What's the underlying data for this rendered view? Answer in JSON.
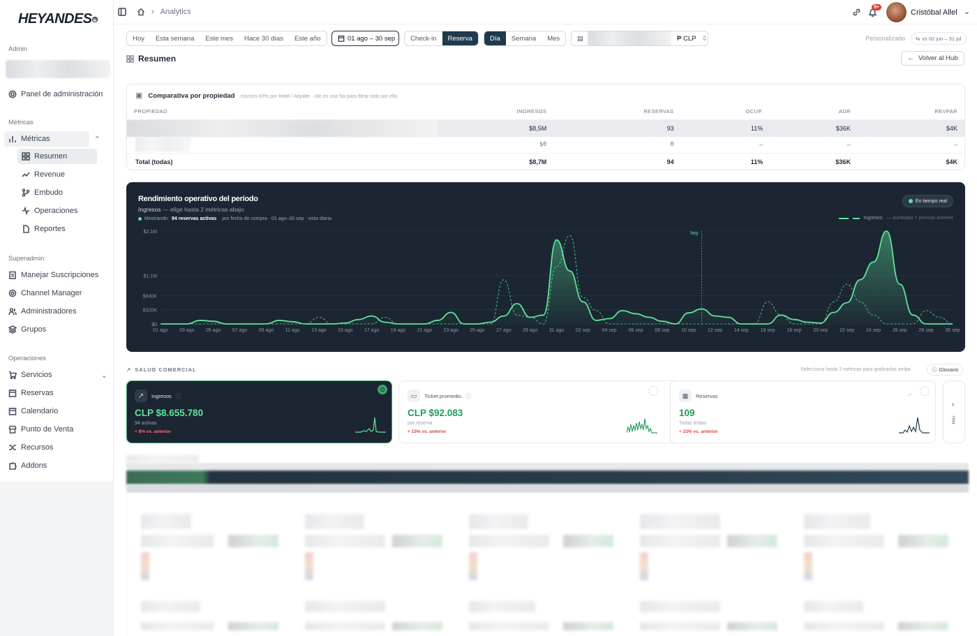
{
  "brand": {
    "logo_text": "HEYANDES"
  },
  "sidebar": {
    "section_admin": "Admin",
    "panel_admin": "Panel de administración",
    "section_metricas": "Métricas",
    "metricas": "Métricas",
    "metricas_items": [
      "Resumen",
      "Revenue",
      "Embudo",
      "Operaciones",
      "Reportes"
    ],
    "section_superadmin": "Superadmin",
    "superadmin_items": [
      "Manejar Suscripciones",
      "Channel Manager",
      "Administradores",
      "Grupos"
    ],
    "section_operaciones": "Operaciones",
    "operaciones_items": [
      "Servicios",
      "Reservas",
      "Calendario",
      "Punto de Venta",
      "Recursos",
      "Addons"
    ]
  },
  "header": {
    "breadcrumb": "Analytics",
    "notifications_badge": "9+",
    "user_name": "Cristóbal Allel"
  },
  "filters": {
    "ranges": [
      "Hoy",
      "Esta semana",
      "Este mes",
      "Hace 30 días",
      "Este año"
    ],
    "date_range": "01 ago – 30 sep",
    "date_type": [
      "Check-in",
      "Reserva"
    ],
    "date_type_selected": "Reserva",
    "granularity": [
      "Día",
      "Semana",
      "Mes"
    ],
    "granularity_selected": "Día",
    "currency": "CLP",
    "compare_label": "Personalizado",
    "compare_range": "vs 02 jun – 31 jul"
  },
  "page": {
    "title": "Resumen",
    "back_button": "Volver al Hub"
  },
  "comparison": {
    "title": "Comparativa por propiedad",
    "subtitle": "mismos KPIs por Hotel / Alquiler · clic en una fila para filtrar todo por ella",
    "columns": [
      "PROPIEDAD",
      "INGRESOS",
      "RESERVAS",
      "OCUP.",
      "ADR",
      "REVPAR"
    ],
    "rows": [
      [
        "",
        "$8,5M",
        "93",
        "11%",
        "$36K",
        "$4K"
      ],
      [
        "",
        "$0",
        "0",
        "–",
        "–",
        "–"
      ]
    ],
    "total": [
      "Total (todas)",
      "$8,7M",
      "94",
      "11%",
      "$36K",
      "$4K"
    ]
  },
  "performance": {
    "title": "Rendimiento operativo del período",
    "subtitle_metric": "Ingresos",
    "subtitle_hint": "— elige hasta 2 métricas abajo",
    "showing_label": "Mostrando:",
    "showing_value": "94 reservas activas",
    "showing_note": "· por fecha de compra · 01 ago–30 sep · vista diaria",
    "realtime": "En tiempo real",
    "legend_series": "Ingresos",
    "legend_note": "— punteado = período anterior",
    "today_label": "hoy"
  },
  "chart_data": {
    "type": "line",
    "series": [
      {
        "name": "Ingresos",
        "style": "solid",
        "color": "#5fe39a",
        "values": [
          0,
          0,
          0,
          80,
          60,
          0,
          0,
          0,
          0,
          80,
          50,
          0,
          0,
          0,
          20,
          100,
          180,
          40,
          0,
          0,
          0,
          80,
          260,
          0,
          0,
          40,
          180,
          460,
          150,
          200,
          1900,
          1200,
          500,
          80,
          120,
          300,
          230,
          150,
          60,
          0,
          250,
          340,
          180,
          150,
          0,
          0,
          0,
          200,
          100,
          40,
          20,
          260,
          480,
          1000,
          1400,
          2100,
          900,
          200,
          0,
          0,
          0,
          0,
          0,
          0,
          0,
          0,
          0,
          0,
          0,
          0,
          0,
          0,
          0,
          0,
          0,
          0,
          0,
          0,
          0,
          0,
          0,
          0,
          0,
          0,
          0,
          0,
          0,
          0,
          0,
          0,
          0,
          0
        ]
      },
      {
        "name": "Ingresos (período anterior)",
        "style": "dashed",
        "color": "#5fe39a",
        "values": [
          0,
          0,
          0,
          0,
          0,
          0,
          0,
          0,
          0,
          0,
          0,
          0,
          150,
          0,
          0,
          0,
          0,
          150,
          0,
          0,
          0,
          0,
          0,
          0,
          0,
          0,
          1000,
          200,
          150,
          0,
          1300,
          2000,
          600,
          300,
          0,
          0,
          0,
          0,
          0,
          0,
          0,
          0,
          0,
          0,
          0,
          0,
          500,
          200,
          0,
          0,
          0,
          500,
          900,
          500,
          200,
          0,
          0,
          0,
          300,
          150,
          0,
          200,
          0,
          0,
          0,
          0,
          0,
          0,
          0,
          0,
          0,
          0,
          0,
          0,
          0,
          0,
          0,
          0,
          0,
          0,
          0,
          0,
          0,
          0,
          0,
          0,
          0,
          0,
          0,
          0,
          0,
          0,
          0,
          0,
          0
        ]
      }
    ],
    "x_ticks": [
      "01 ago",
      "03 ago",
      "05 ago",
      "07 ago",
      "09 ago",
      "11 ago",
      "13 ago",
      "15 ago",
      "17 ago",
      "19 ago",
      "21 ago",
      "23 ago",
      "25 ago",
      "27 ago",
      "29 ago",
      "31 ago",
      "02 sep",
      "04 sep",
      "06 sep",
      "08 sep",
      "10 sep",
      "12 sep",
      "14 sep",
      "16 sep",
      "18 sep",
      "20 sep",
      "22 sep",
      "24 sep",
      "26 sep",
      "28 sep",
      "30 sep"
    ],
    "y_ticks": [
      "$2,1M",
      "$1,1M",
      "$640K",
      "$320K",
      "$0"
    ],
    "y_tick_values": [
      2100000,
      1100000,
      640000,
      320000,
      0
    ]
  },
  "health": {
    "title": "SALUD COMERCIAL",
    "hint": "Selecciona hasta 2 métricas para graficarlas arriba",
    "glossary": "Glosario",
    "more": "Más",
    "kpis": [
      {
        "label": "Ingresos",
        "value": "CLP $8.655.780",
        "sub": "94 activas",
        "delta": "+ 8% vs. anterior"
      },
      {
        "label": "Ticket promedio",
        "value": "CLP $92.083",
        "sub": "por reserva",
        "delta": "+ 15% vs. anterior"
      },
      {
        "label": "Reservas",
        "value": "109",
        "sub": "Todas leídas",
        "delta": "+ 23% vs. anterior"
      }
    ]
  }
}
